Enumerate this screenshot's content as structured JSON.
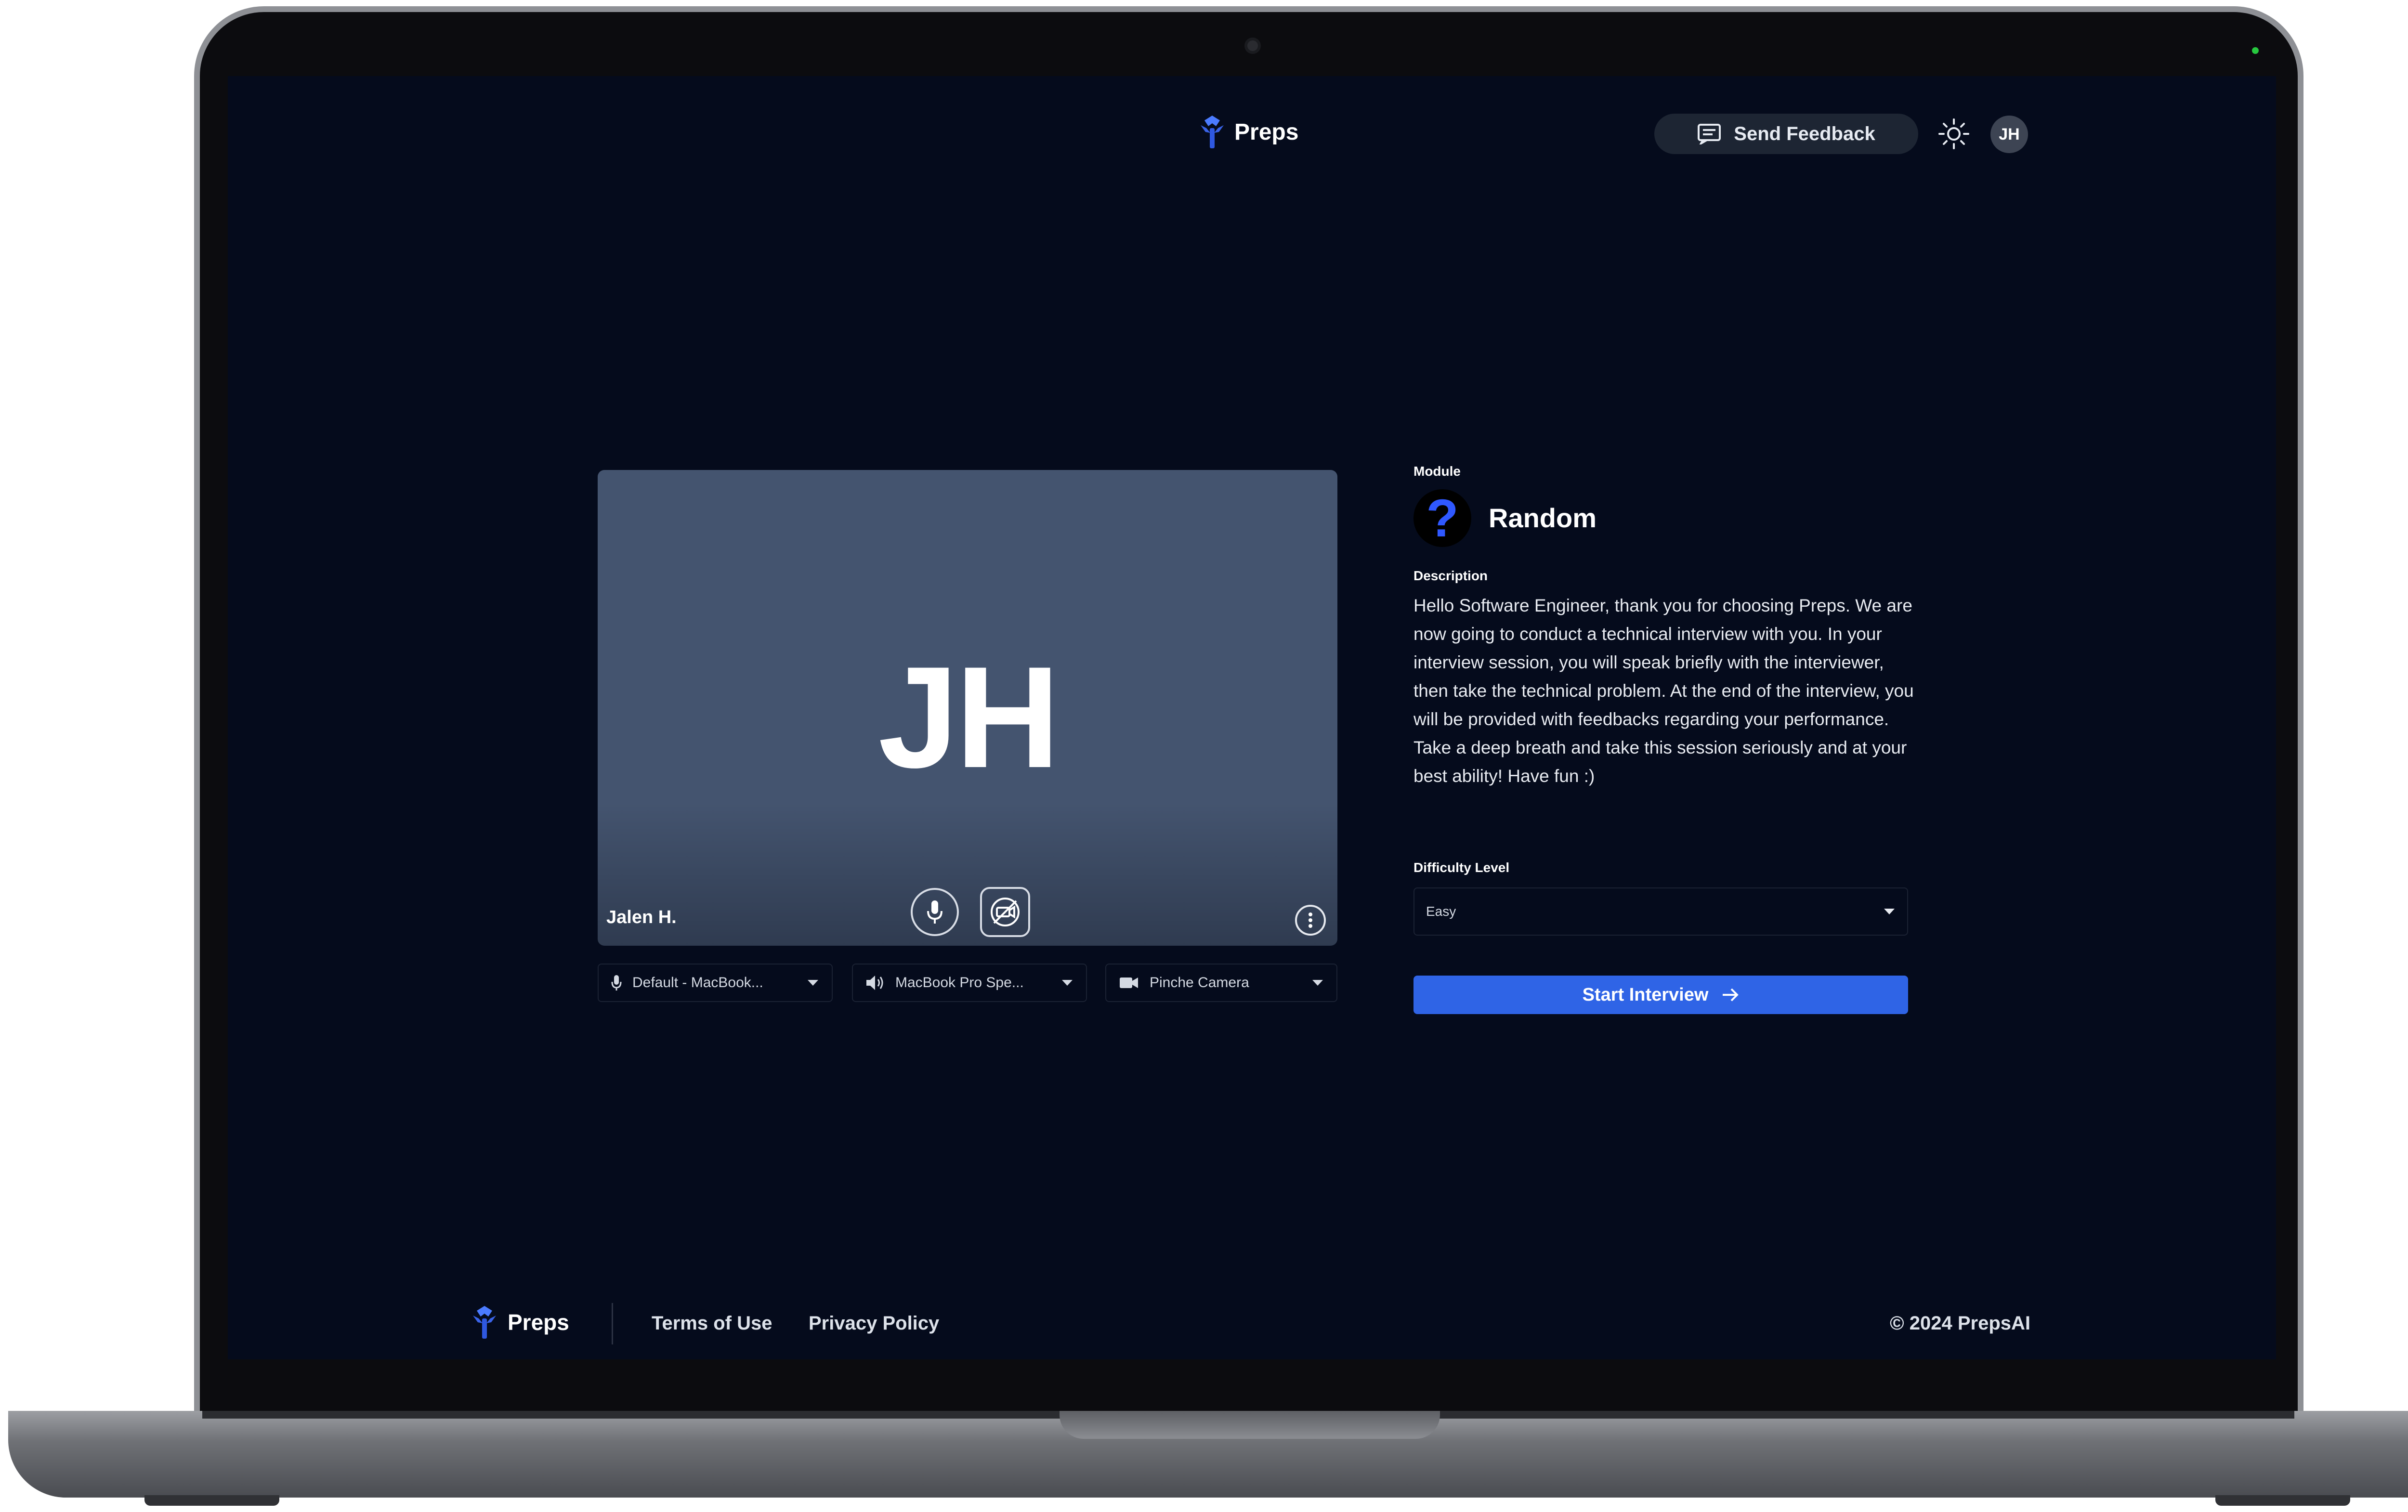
{
  "header": {
    "brand_name": "Preps",
    "feedback_label": "Send Feedback",
    "avatar_initials": "JH"
  },
  "video": {
    "initials": "JH",
    "participant_name": "Jalen H."
  },
  "devices": {
    "microphone": "Default - MacBook...",
    "speaker": "MacBook Pro Spe...",
    "camera": "Pinche Camera"
  },
  "module": {
    "section_label": "Module",
    "icon_glyph": "?",
    "name": "Random",
    "description_label": "Description",
    "description": "Hello Software Engineer, thank you for choosing Preps. We are now going to conduct a technical interview with you. In your interview session, you will speak briefly with the interviewer, then take the technical problem. At the end of the interview, you will be provided with feedbacks regarding your performance. Take a deep breath and take this session seriously and at your best ability! Have fun :)",
    "difficulty_label": "Difficulty Level",
    "difficulty_value": "Easy",
    "start_label": "Start Interview"
  },
  "footer": {
    "brand_name": "Preps",
    "terms": "Terms of Use",
    "privacy": "Privacy Policy",
    "copyright": "© 2024 PrepsAI"
  },
  "colors": {
    "background": "#050b1c",
    "accent": "#2f64e6",
    "video_tile": "#44546f"
  },
  "icons": [
    "preps-logo-icon",
    "feedback-icon",
    "sun-icon",
    "mic-icon",
    "camera-off-icon",
    "more-icon",
    "speaker-icon",
    "video-camera-icon",
    "chevron-down-icon",
    "arrow-right-icon"
  ]
}
